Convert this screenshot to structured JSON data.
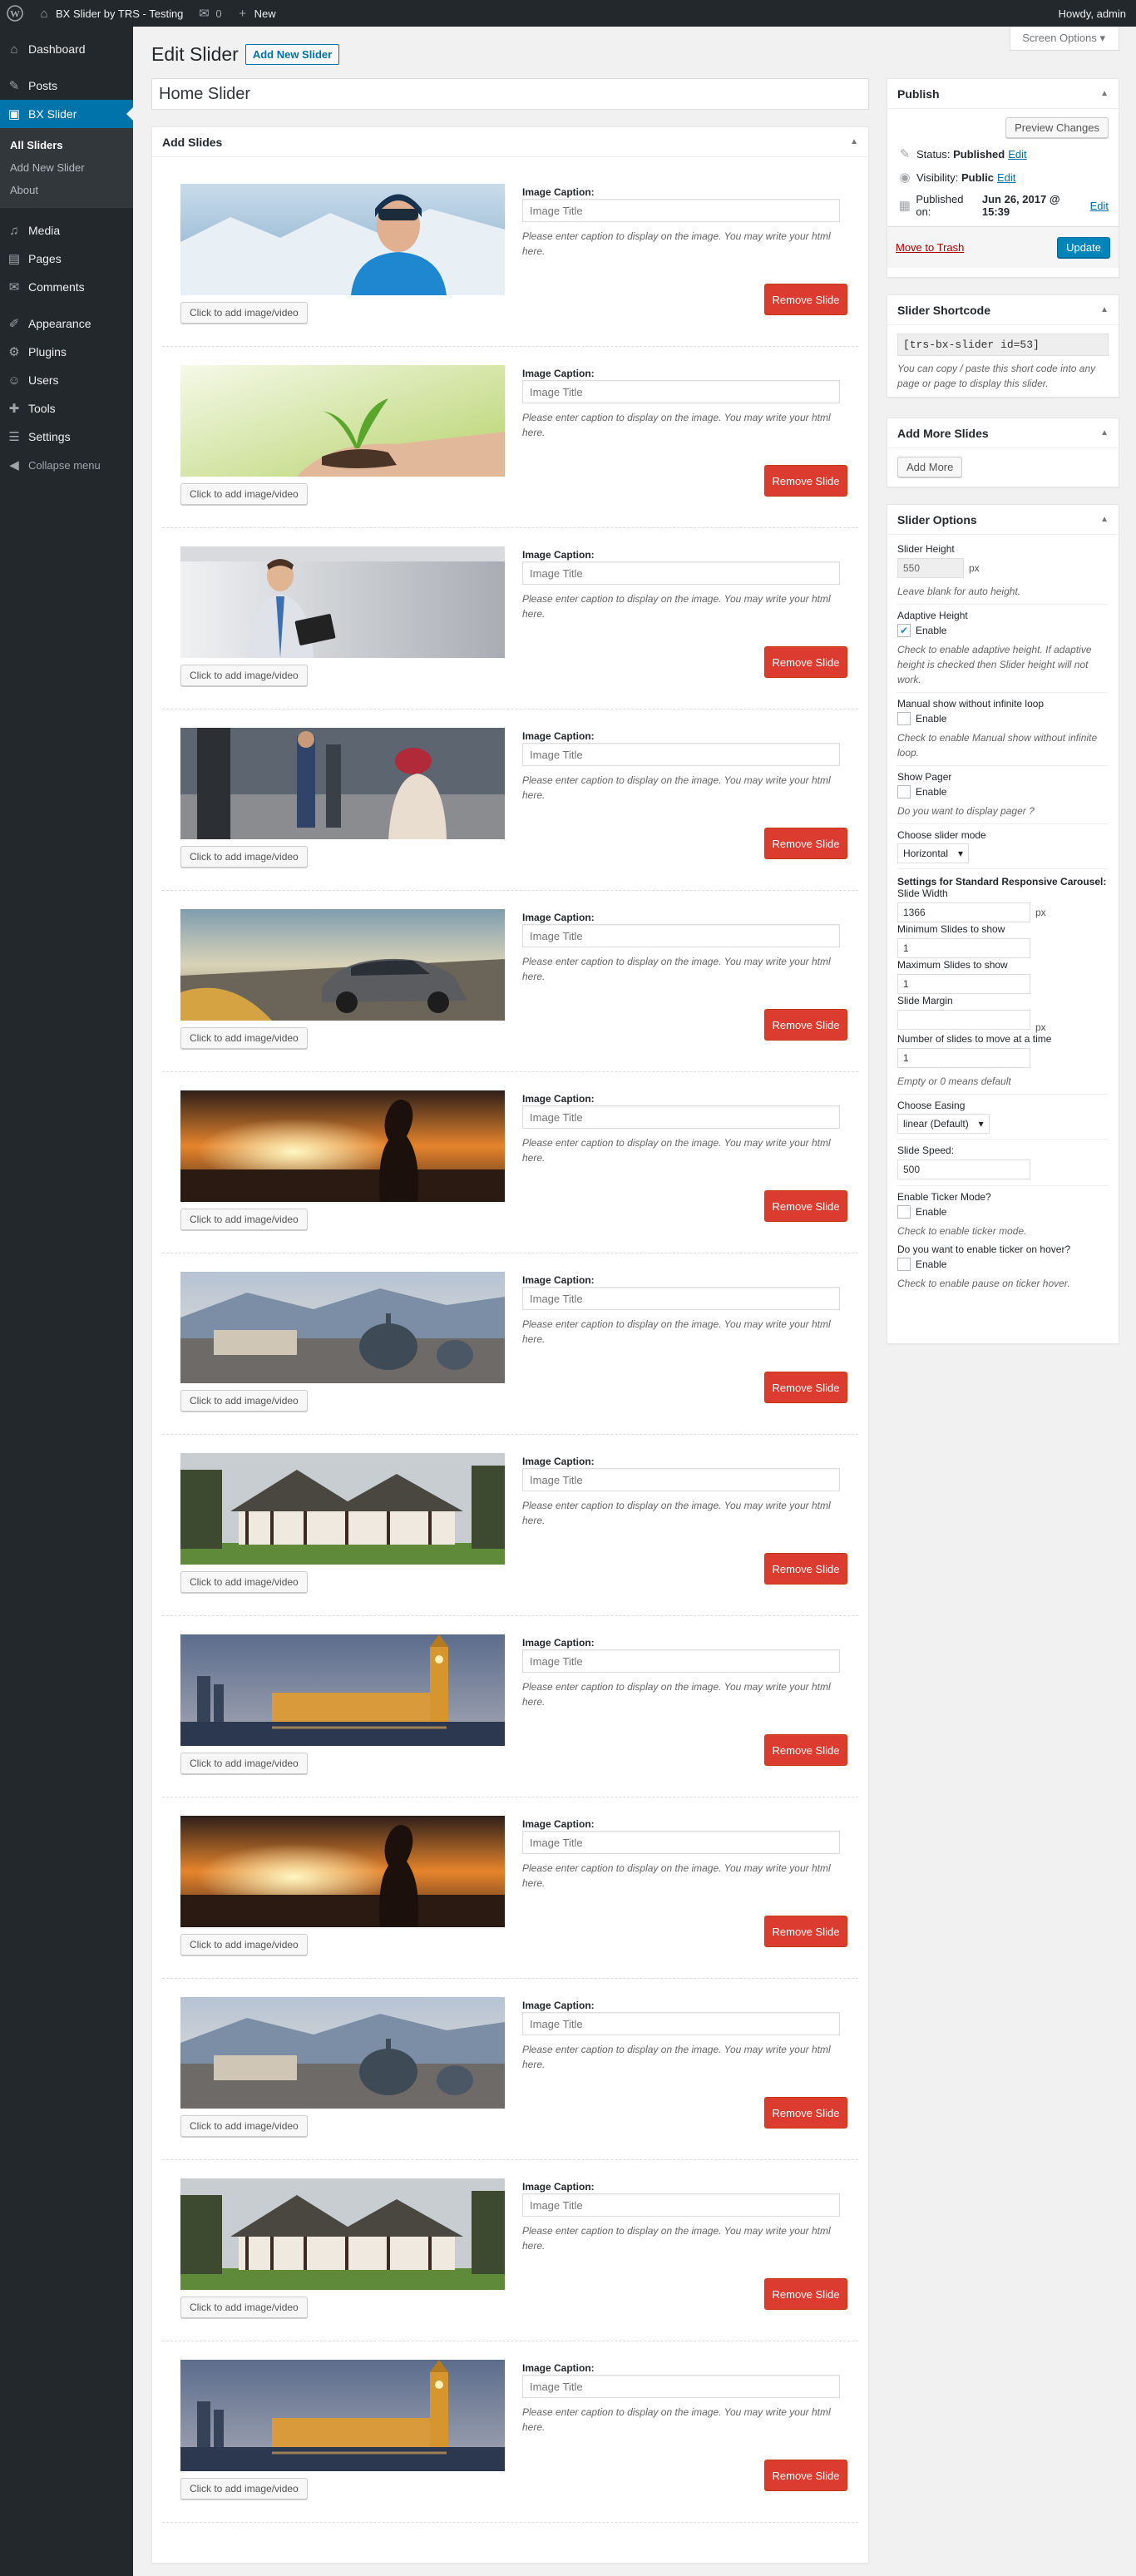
{
  "adminbar": {
    "site_name": "BX Slider by TRS - Testing",
    "comments_count": "0",
    "new_label": "New",
    "howdy": "Howdy, admin"
  },
  "sidebar": {
    "items": [
      {
        "label": "Dashboard",
        "icon": "dashboard-icon",
        "glyph": "⌂"
      },
      {
        "label": "Posts",
        "icon": "pin-icon",
        "glyph": "✎"
      },
      {
        "label": "BX Slider",
        "icon": "slider-icon",
        "glyph": "▣"
      },
      {
        "label": "Media",
        "icon": "media-icon",
        "glyph": "♫"
      },
      {
        "label": "Pages",
        "icon": "pages-icon",
        "glyph": "▤"
      },
      {
        "label": "Comments",
        "icon": "comments-icon",
        "glyph": "✉"
      },
      {
        "label": "Appearance",
        "icon": "brush-icon",
        "glyph": "✐"
      },
      {
        "label": "Plugins",
        "icon": "plugin-icon",
        "glyph": "⚙"
      },
      {
        "label": "Users",
        "icon": "users-icon",
        "glyph": "☺"
      },
      {
        "label": "Tools",
        "icon": "wrench-icon",
        "glyph": "✚"
      },
      {
        "label": "Settings",
        "icon": "settings-icon",
        "glyph": "☰"
      }
    ],
    "submenu": [
      "All Sliders",
      "Add New Slider",
      "About"
    ],
    "collapse": "Collapse menu"
  },
  "screen_options": "Screen Options",
  "page": {
    "title": "Edit Slider",
    "add_new": "Add New Slider",
    "post_title": "Home Slider"
  },
  "slides_box": {
    "title": "Add Slides",
    "caption_label": "Image Caption:",
    "caption_placeholder": "Image Title",
    "caption_desc": "Please enter caption to display on the image. You may write your html here.",
    "add_media_label": "Click to add image/video",
    "remove_label": "Remove Slide",
    "slides": [
      {
        "image": "skier-portrait"
      },
      {
        "image": "plant-in-hands"
      },
      {
        "image": "businessman-tablet"
      },
      {
        "image": "street-people"
      },
      {
        "image": "sports-car"
      },
      {
        "image": "sunset-silhouette"
      },
      {
        "image": "city-domes"
      },
      {
        "image": "tudor-house"
      },
      {
        "image": "big-ben-night"
      },
      {
        "image": "sunset-silhouette"
      },
      {
        "image": "city-domes"
      },
      {
        "image": "tudor-house"
      },
      {
        "image": "big-ben-night"
      }
    ]
  },
  "publish": {
    "title": "Publish",
    "preview": "Preview Changes",
    "status_label": "Status:",
    "status_value": "Published",
    "visibility_label": "Visibility:",
    "visibility_value": "Public",
    "published_label": "Published on:",
    "published_value": "Jun 26, 2017 @ 15:39",
    "edit": "Edit",
    "trash": "Move to Trash",
    "update": "Update"
  },
  "shortcode": {
    "title": "Slider Shortcode",
    "code": "[trs-bx-slider id=53]",
    "help": "You can copy / paste this short code into any page or page to display this slider."
  },
  "add_more": {
    "title": "Add More Slides",
    "button": "Add More"
  },
  "options": {
    "title": "Slider Options",
    "height_label": "Slider Height",
    "height_value": "550",
    "px": "px",
    "height_help": "Leave blank for auto height.",
    "adaptive_label": "Adaptive Height",
    "enable": "Enable",
    "adaptive_help": "Check to enable adaptive height. If adaptive height is checked then Slider height will not work.",
    "manual_label": "Manual show without infinite loop",
    "manual_help": "Check to enable Manual show without infinite loop.",
    "pager_label": "Show Pager",
    "pager_help": "Do you want to display pager ?",
    "mode_label": "Choose slider mode",
    "mode_value": "Horizontal",
    "carousel_head": "Settings for Standard Responsive Carousel:",
    "width_label": "Slide Width",
    "width_value": "1366",
    "min_label": "Minimum Slides to show",
    "min_value": "1",
    "max_label": "Maximum Slides to show",
    "max_value": "1",
    "margin_label": "Slide Margin",
    "margin_value": "",
    "move_label": "Number of slides to move at a time",
    "move_value": "1",
    "move_help": "Empty or 0 means default",
    "easing_label": "Choose Easing",
    "easing_value": "linear (Default)",
    "speed_label": "Slide Speed:",
    "speed_value": "500",
    "ticker_label": "Enable Ticker Mode?",
    "ticker_help": "Check to enable ticker mode.",
    "hover_label": "Do you want to enable ticker on hover?",
    "hover_help": "Check to enable pause on ticker hover."
  }
}
